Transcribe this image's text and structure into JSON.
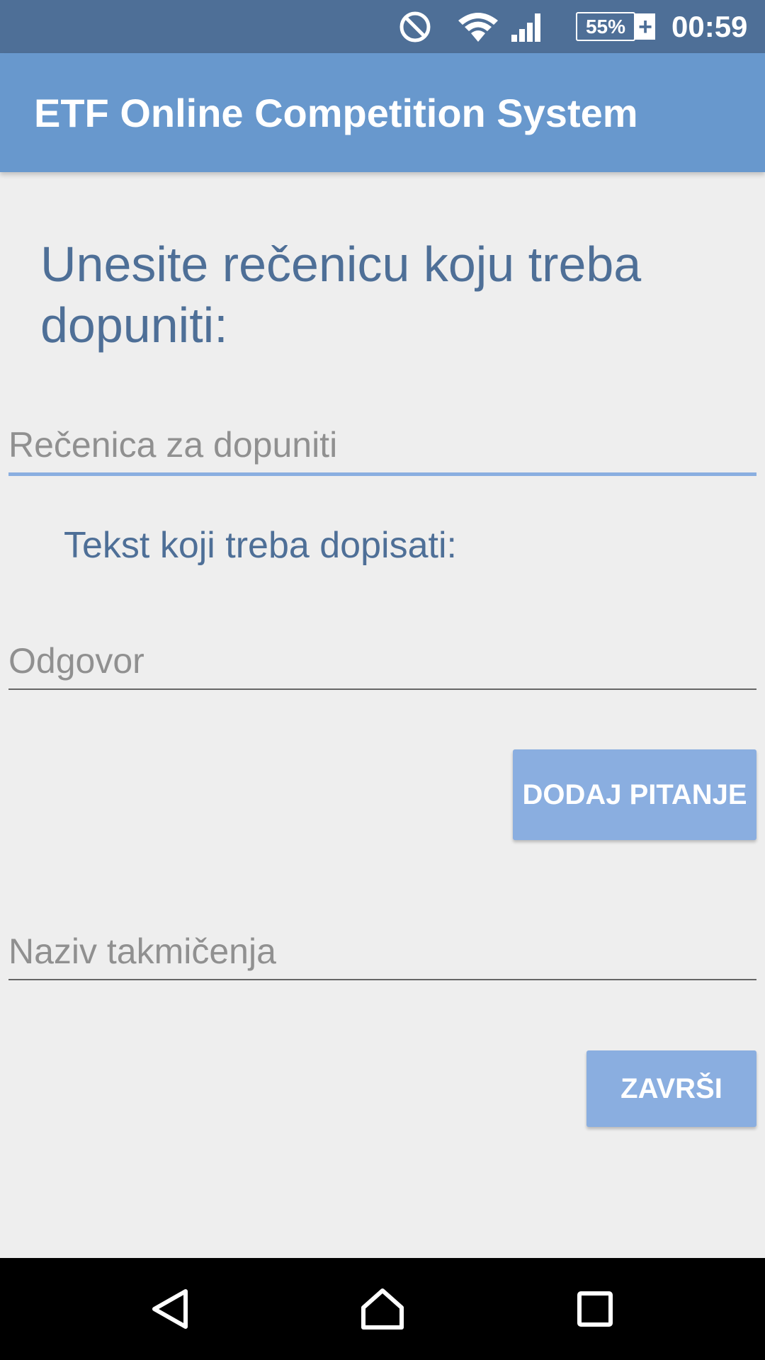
{
  "status_bar": {
    "battery_percent": "55%",
    "battery_plug": "+",
    "time": "00:59",
    "icons": [
      "do-not-disturb-icon",
      "wifi-icon",
      "signal-icon",
      "battery-charging-icon"
    ]
  },
  "app_bar": {
    "title": "ETF Online Competition System"
  },
  "form": {
    "heading": "Unesite rečenicu koju treba dopuniti:",
    "sentence_placeholder": "Rečenica za dopuniti",
    "text_label": "Tekst koji treba dopisati:",
    "answer_placeholder": "Odgovor",
    "add_question_button": "DODAJ PITANJE",
    "competition_name_placeholder": "Naziv takmičenja",
    "finish_button": "ZAVRŠI"
  },
  "nav_bar": {
    "icons": [
      "back-icon",
      "home-icon",
      "recents-icon"
    ]
  },
  "colors": {
    "status_bar": "#4e6f97",
    "app_bar": "#6898cd",
    "accent_text": "#4e6f97",
    "button": "#8aaee0",
    "background": "#eeeeee"
  }
}
